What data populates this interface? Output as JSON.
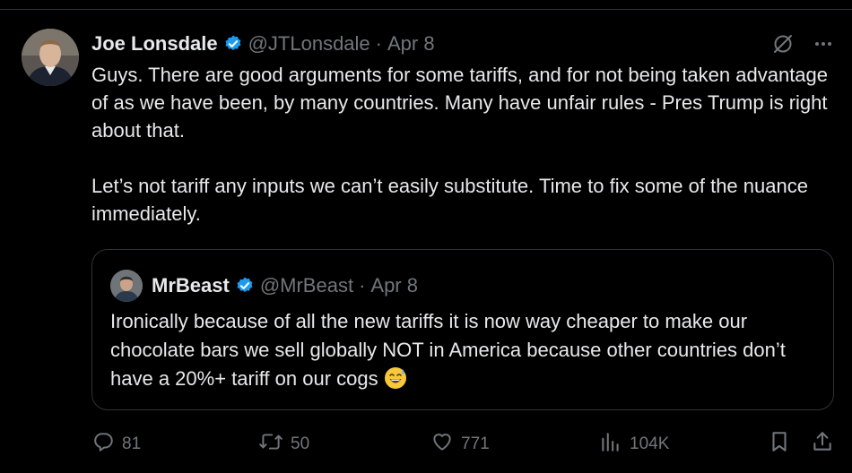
{
  "author": {
    "name": "Joe Lonsdale",
    "handle": "@JTLonsdale",
    "separator": "·",
    "date": "Apr 8"
  },
  "tweet": {
    "text": "Guys. There are good arguments for some tariffs, and for not being taken advantage of as we have been, by many countries. Many have unfair rules - Pres Trump is right about that.\n\nLet’s not tariff any inputs we can’t easily substitute. Time to fix some of the nuance immediately."
  },
  "quoted": {
    "name": "MrBeast",
    "handle": "@MrBeast",
    "separator": "·",
    "date": "Apr 8",
    "text": "Ironically because of all the new tariffs it is now way cheaper to make our chocolate bars we sell globally NOT in America because other countries don’t have a 20%+ tariff on our cogs",
    "emoji": "sweat-smile-emoji"
  },
  "metrics": {
    "replies": "81",
    "reposts": "50",
    "likes": "771",
    "views": "104K"
  },
  "colors": {
    "background": "#000000",
    "text": "#e7e9ea",
    "muted": "#71767b",
    "border": "#2f3336",
    "verified": "#1d9bf0"
  },
  "icons": [
    "verified-badge-icon",
    "grok-icon",
    "more-icon",
    "reply-icon",
    "repost-icon",
    "like-icon",
    "views-icon",
    "bookmark-icon",
    "share-icon"
  ]
}
